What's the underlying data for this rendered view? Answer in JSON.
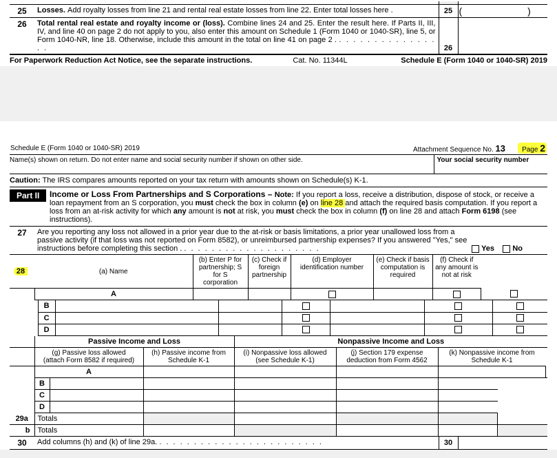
{
  "page1": {
    "line25": {
      "num": "25",
      "text_a": "Losses. ",
      "text_b": "Add royalty losses from line 21 and rental real estate losses from line 22. Enter total losses here .",
      "fieldnum": "25"
    },
    "line26": {
      "num": "26",
      "text_a": "Total rental real estate and royalty income or (loss). ",
      "text_b": "Combine lines 24 and 25. Enter the result here. If Parts II, III, IV, and line 40 on page 2 do not apply to you, also enter this amount on Schedule 1 (Form 1040 or 1040-SR), line 5, or Form 1040-NR, line 18. Otherwise, include this amount in the total on line 41 on page 2 .",
      "fieldnum": "26"
    },
    "footer_left": "For Paperwork Reduction Act Notice, see the separate instructions.",
    "footer_mid": "Cat. No. 11344L",
    "footer_right": "Schedule E (Form 1040 or 1040-SR) 2019"
  },
  "page2": {
    "header_left": "Schedule E (Form 1040 or 1040-SR) 2019",
    "header_attach": "Attachment Sequence No.",
    "header_seq": "13",
    "header_page_a": "Page ",
    "header_page_b": "2",
    "names_label": "Name(s) shown on return. Do not enter name and social security number if shown on other side.",
    "ssn_label": "Your social security number",
    "caution_a": "Caution:",
    "caution_b": "The IRS compares amounts reported on your tax return with amounts shown on Schedule(s) K-1.",
    "part2_label": "Part II",
    "part2_title": "Income or Loss From Partnerships and S Corporations – ",
    "part2_note_head": "Note: ",
    "part2_note_1": "If you report a loss, receive a distribution, dispose of stock, or receive a loan repayment from an S corporation, you ",
    "part2_bold_must": "must",
    "part2_note_2": " check the box in column ",
    "part2_bold_e": "(e)",
    "part2_note_3": " on ",
    "part2_hl": "line 28 ",
    "part2_note_3b": "and attach the required basis computation. If you report a loss from an at-risk activity for which ",
    "part2_bold_any": "any",
    "part2_note_4": " amount is ",
    "part2_bold_not": "not",
    "part2_note_5": " at risk, you ",
    "part2_note_6": " check the box in column ",
    "part2_bold_f": "(f)",
    "part2_note_7": " on line 28 and attach ",
    "part2_bold_6198": "Form 6198",
    "part2_note_8": " (see instructions).",
    "line27": {
      "num": "27",
      "text": "Are you reporting any loss not allowed in a prior year due to the at-risk or basis limitations, a prior year unallowed loss from a passive activity (if that loss was not reported on Form 8582), or unreimbursed partnership expenses? If you answered \"Yes,\" see instructions before completing this section .",
      "yes": "Yes",
      "no": "No"
    },
    "line28": {
      "num": "28",
      "col_a": "(a)  Name",
      "col_b": "(b)  Enter P for partnership; S for S corporation",
      "col_c": "(c)  Check if foreign partnership",
      "col_d": "(d)  Employer identification number",
      "col_e": "(e)  Check if basis computation is required",
      "col_f": "(f)  Check if any amount is not at risk"
    },
    "rows": [
      "A",
      "B",
      "C",
      "D"
    ],
    "passive_hdr": "Passive Income and Loss",
    "nonpassive_hdr": "Nonpassive Income and Loss",
    "col_g_1": "(g)  Passive loss allowed",
    "col_g_2": "(attach Form 8582 if required)",
    "col_h": "(h)  Passive income from Schedule K-1",
    "col_i": "(i)  Nonpassive loss allowed (see Schedule K-1)",
    "col_j": "(j)  Section 179 expense deduction from Form 4562",
    "col_k": "(k)  Nonpassive income from Schedule K-1",
    "line29a_num": "29a",
    "line29a_text": "Totals",
    "line29b_num": "b",
    "line29b_text": "Totals",
    "line30_num": "30",
    "line30_a": "Add columns (h) and (k) of line 29a.",
    "line30_field": "30"
  }
}
